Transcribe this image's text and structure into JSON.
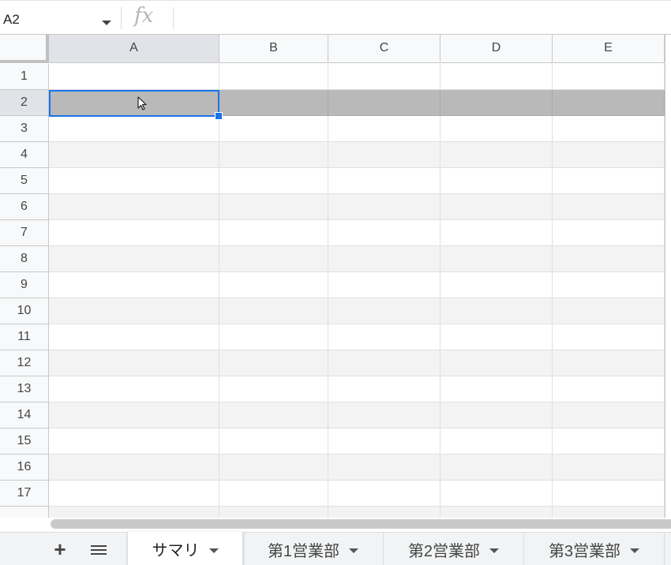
{
  "formula_bar": {
    "name_box": "A2",
    "fx": "fx",
    "formula": ""
  },
  "columns": [
    "A",
    "B",
    "C",
    "D",
    "E"
  ],
  "rows": [
    "1",
    "2",
    "3",
    "4",
    "5",
    "6",
    "7",
    "8",
    "9",
    "10",
    "11",
    "12",
    "13",
    "14",
    "15",
    "16",
    "17"
  ],
  "selection": {
    "active_cell": "A2",
    "highlighted_row": "2"
  },
  "colors": {
    "accent": "#1a73e8",
    "row_highlight": "#b9b9b9",
    "alt_row": "#f2f3f2",
    "header_bg": "#f8f9fa"
  },
  "sheet_tabs": [
    {
      "label": "サマリ",
      "active": true
    },
    {
      "label": "第1営業部",
      "active": false
    },
    {
      "label": "第2営業部",
      "active": false
    },
    {
      "label": "第3営業部",
      "active": false
    }
  ],
  "icons": {
    "add_sheet": "plus-icon",
    "all_sheets": "menu-icon",
    "name_box_dropdown": "chevron-down-icon",
    "cursor": "pointer-cursor-icon"
  }
}
